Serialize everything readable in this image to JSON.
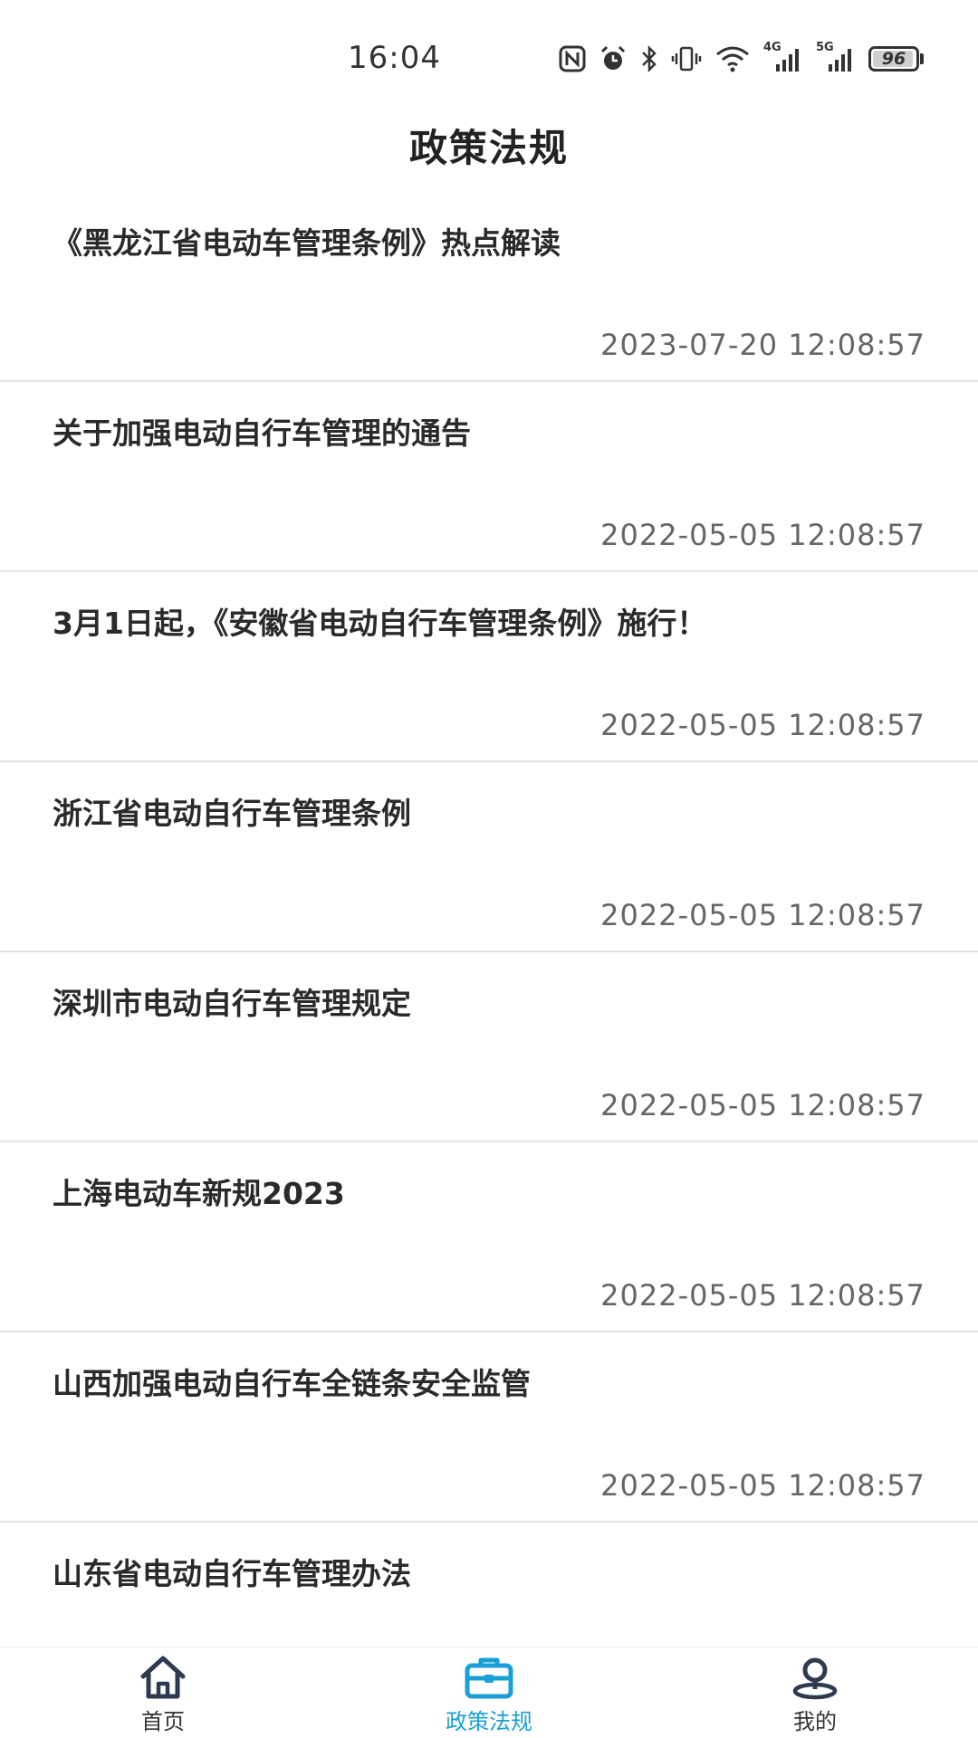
{
  "status_bar": {
    "time": "16:04",
    "battery": "96",
    "signal_1_label": "4G",
    "signal_2_label": "5G"
  },
  "header": {
    "title": "政策法规"
  },
  "news": [
    {
      "title": "《黑龙江省电动车管理条例》热点解读",
      "time": "2023-07-20 12:08:57"
    },
    {
      "title": "关于加强电动自行车管理的通告",
      "time": "2022-05-05 12:08:57"
    },
    {
      "title": "3月1日起，《安徽省电动自行车管理条例》施行！",
      "time": "2022-05-05 12:08:57"
    },
    {
      "title": "浙江省电动自行车管理条例",
      "time": "2022-05-05 12:08:57"
    },
    {
      "title": "深圳市电动自行车管理规定",
      "time": "2022-05-05 12:08:57"
    },
    {
      "title": "上海电动车新规2023",
      "time": "2022-05-05 12:08:57"
    },
    {
      "title": "山西加强电动自行车全链条安全监管",
      "time": "2022-05-05 12:08:57"
    },
    {
      "title": "山东省电动自行车管理办法",
      "time": ""
    }
  ],
  "bottom_nav": {
    "tabs": [
      {
        "label": "首页",
        "icon": "home-icon"
      },
      {
        "label": "政策法规",
        "icon": "briefcase-icon"
      },
      {
        "label": "我的",
        "icon": "user-pin-icon"
      }
    ],
    "active_color": "#1a9fd6",
    "inactive_color": "#333333"
  }
}
